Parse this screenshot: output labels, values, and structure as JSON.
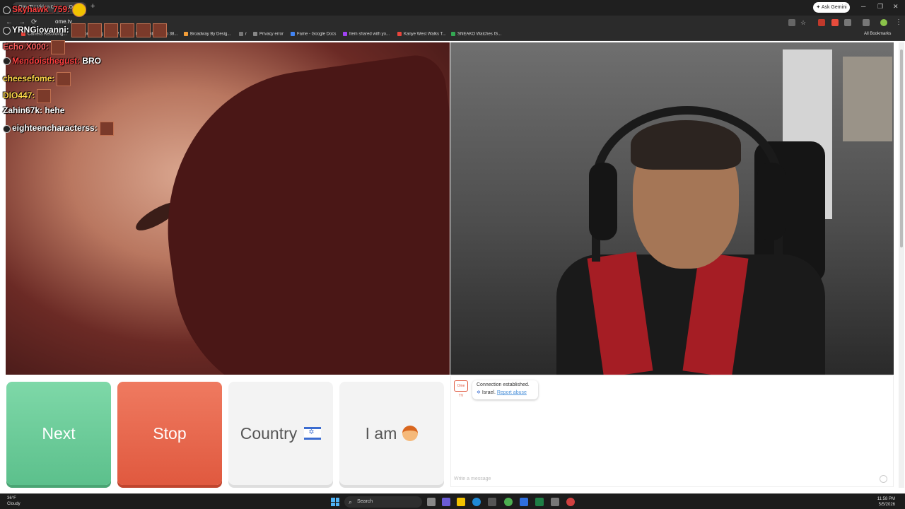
{
  "browser": {
    "tab_title": "OmeTV Video Chat — Ome",
    "url": "ome.tv",
    "gemini_label": "Ask Gemini",
    "all_bookmarks": "All Bookmarks",
    "bookmarks": [
      {
        "label": "Camera Recording...",
        "color": "#e8453c"
      },
      {
        "label": "Configuring SonicW...",
        "color": "#34a853"
      },
      {
        "label": "Epson Stylus Pro 38...",
        "color": "#4285f4"
      },
      {
        "label": "Broadway By Desig...",
        "color": "#f29d38"
      },
      {
        "label": "r",
        "color": "#777777"
      },
      {
        "label": "Privacy error",
        "color": "#888888"
      },
      {
        "label": "Fame - Google Docs",
        "color": "#4285f4"
      },
      {
        "label": "Item shared with yo...",
        "color": "#a142f4"
      },
      {
        "label": "Kanye West Walks T...",
        "color": "#e8453c"
      },
      {
        "label": "SNEAKO Watches IS...",
        "color": "#34a853"
      }
    ]
  },
  "stream_chat": [
    {
      "user": "Skyhawk_759:",
      "text": "",
      "color": "#ff4040"
    },
    {
      "user": "YRNGiovanni:",
      "text": "",
      "color": "#ffffff"
    },
    {
      "user": "Echo X000:",
      "text": "",
      "color": "#ff6060"
    },
    {
      "user": "Mendoisthegust:",
      "text": "BRO",
      "color": "#ff4040"
    },
    {
      "user": "cheesefome:",
      "text": "",
      "color": "#ffd84a"
    },
    {
      "user": "DIO447:",
      "text": "",
      "color": "#ffd84a"
    },
    {
      "user": "Zahin67k:",
      "text": "hehe",
      "color": "#ffffff"
    },
    {
      "user": "eighteencharacterss:",
      "text": "",
      "color": "#ffffff"
    }
  ],
  "controls": {
    "next": "Next",
    "stop": "Stop",
    "country": "Country",
    "iam": "I am"
  },
  "chat_panel": {
    "logo": "Ome TV",
    "status": "Connection established.",
    "country": "Israel.",
    "report": "Report abuse",
    "input_placeholder": "Write a message"
  },
  "taskbar": {
    "temp": "36°F",
    "condition": "Cloudy",
    "search": "Search",
    "time": "11:58 PM",
    "date": "5/5/2026"
  }
}
